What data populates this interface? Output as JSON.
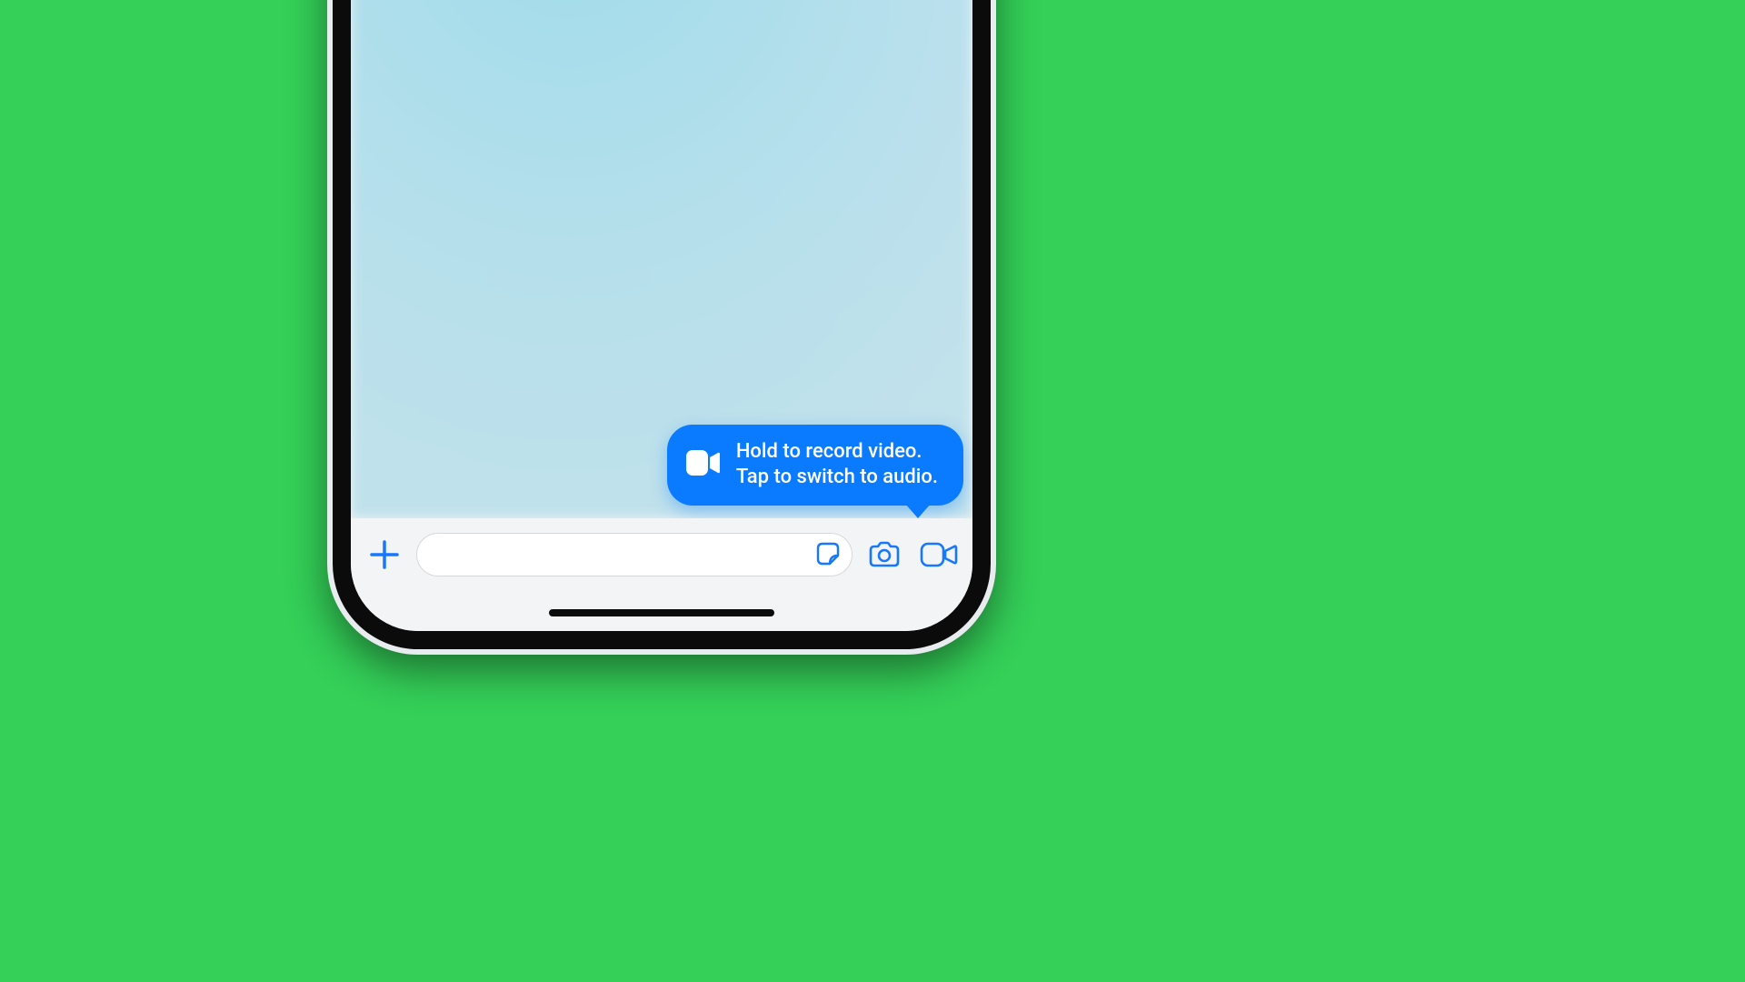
{
  "colors": {
    "accent": "#0a7aff",
    "page_bg": "#34d058"
  },
  "tooltip": {
    "line1": "Hold to record video.",
    "line2": "Tap to switch to audio.",
    "icon": "video-icon"
  },
  "inputbar": {
    "add_icon": "plus-icon",
    "message_placeholder": "",
    "sticker_icon": "sticker-icon",
    "camera_icon": "camera-icon",
    "video_icon": "video-icon"
  }
}
